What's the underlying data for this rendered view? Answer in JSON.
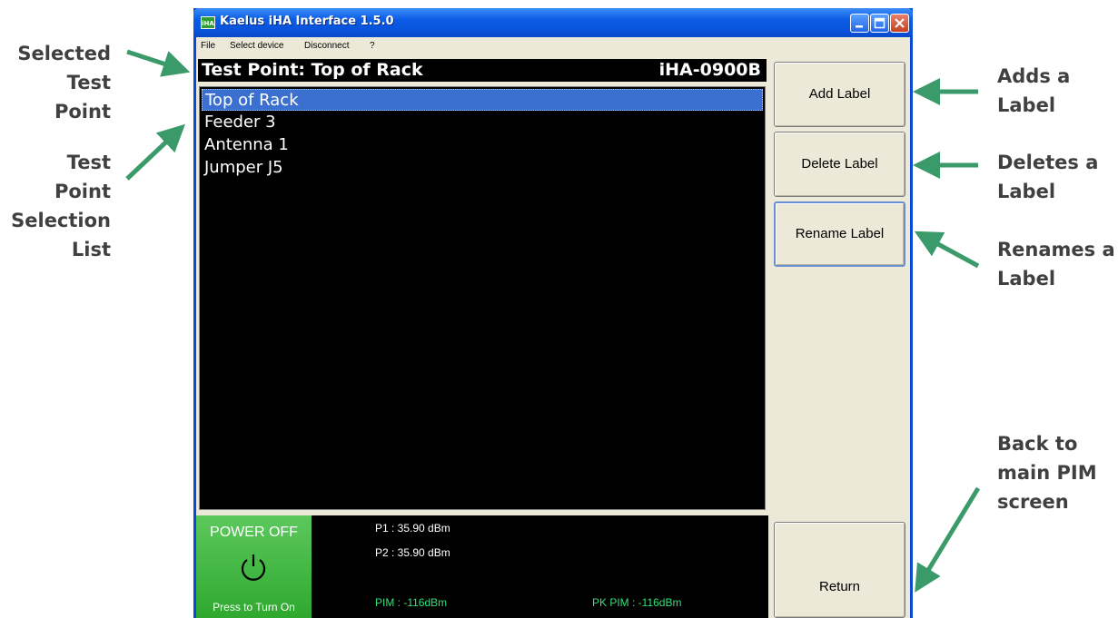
{
  "annotations": {
    "selected_test_point": [
      "Selected",
      "Test Point"
    ],
    "selection_list": [
      "Test Point",
      "Selection",
      "List"
    ],
    "adds_label": [
      "Adds a",
      "Label"
    ],
    "deletes_label": [
      "Deletes a",
      "Label"
    ],
    "renames_label": [
      "Renames a",
      "Label"
    ],
    "back_main": [
      "Back to",
      "main PIM",
      "screen"
    ],
    "arrow_color": "#3a9a6a"
  },
  "window": {
    "title": "Kaelus iHA Interface 1.5.0",
    "icon_text": "iHA",
    "controls": [
      "minimize-icon",
      "maximize-icon",
      "close-icon"
    ]
  },
  "menu": {
    "items": [
      "File",
      "Select device",
      "Disconnect",
      "?"
    ]
  },
  "header": {
    "title": "Test Point: Top of Rack",
    "device": "iHA-0900B"
  },
  "test_points": {
    "items": [
      "Top of Rack",
      "Feeder 3",
      "Antenna 1",
      "Jumper J5"
    ],
    "selected_index": 0
  },
  "buttons": {
    "add": "Add Label",
    "delete": "Delete Label",
    "rename": "Rename Label",
    "return": "Return"
  },
  "status": {
    "power_title": "POWER OFF",
    "power_sub": "Press to Turn On",
    "p1": "P1 : 35.90 dBm",
    "p2": "P2 : 35.90 dBm",
    "pim": "PIM : -116dBm",
    "pk_pim": "PK PIM : -116dBm",
    "power_color": "#3db53d",
    "reading_color": "#34e07a"
  }
}
